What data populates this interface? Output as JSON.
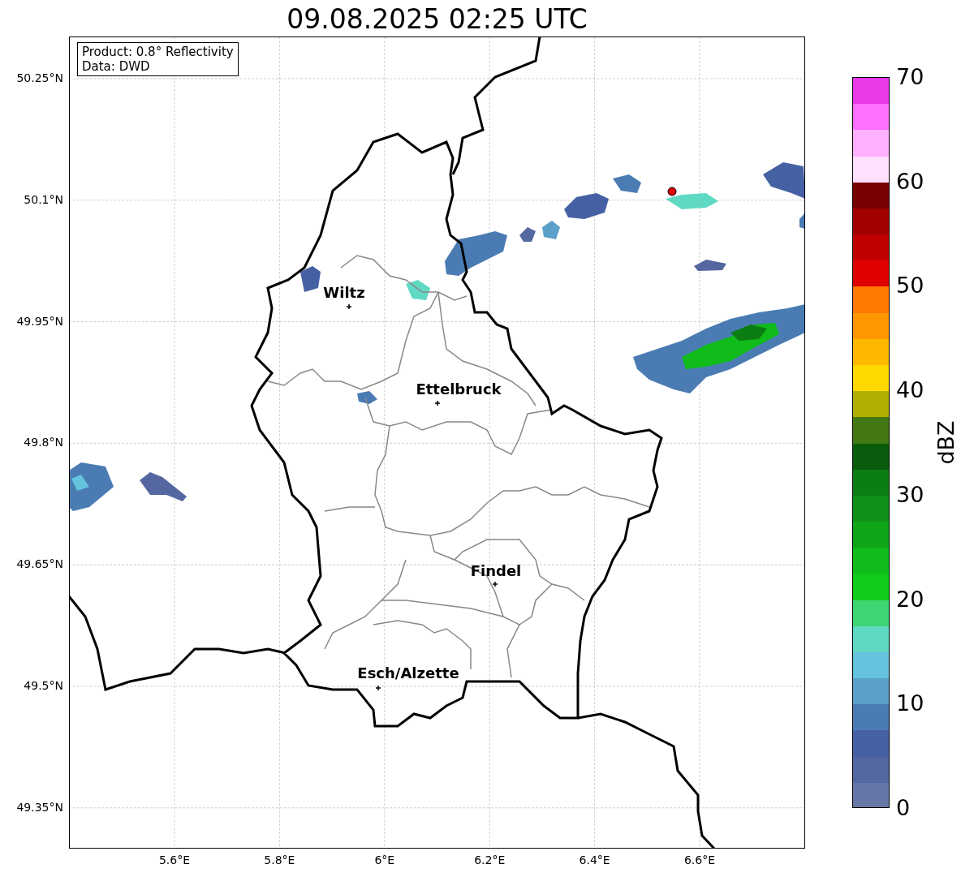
{
  "title": "09.08.2025 02:25 UTC",
  "info_box": {
    "lines": [
      "Product: 0.8° Reflectivity",
      "Data: DWD"
    ]
  },
  "map": {
    "x_ticks": [
      "5.6°E",
      "5.8°E",
      "6°E",
      "6.2°E",
      "6.4°E",
      "6.6°E"
    ],
    "y_ticks": [
      "50.25°N",
      "50.1°N",
      "49.95°N",
      "49.8°N",
      "49.65°N",
      "49.5°N",
      "49.35°N"
    ],
    "cities": [
      {
        "name": "Wiltz"
      },
      {
        "name": "Ettelbruck"
      },
      {
        "name": "Findel"
      },
      {
        "name": "Esch/Alzette"
      }
    ]
  },
  "colorbar": {
    "label": "dBZ",
    "ticks": [
      "70",
      "60",
      "50",
      "40",
      "30",
      "20",
      "10",
      "0"
    ],
    "segments": [
      {
        "color": "#e838e8"
      },
      {
        "color": "#ff70ff"
      },
      {
        "color": "#ffb0ff"
      },
      {
        "color": "#ffe0ff"
      },
      {
        "color": "#780000"
      },
      {
        "color": "#a00000"
      },
      {
        "color": "#c00000"
      },
      {
        "color": "#e00000"
      },
      {
        "color": "#ff7800"
      },
      {
        "color": "#ff9800"
      },
      {
        "color": "#ffb800"
      },
      {
        "color": "#ffd800"
      },
      {
        "color": "#b0b000"
      },
      {
        "color": "#447812"
      },
      {
        "color": "#085c0c"
      },
      {
        "color": "#0c7d12"
      },
      {
        "color": "#0f9016"
      },
      {
        "color": "#10a418"
      },
      {
        "color": "#10bb1a"
      },
      {
        "color": "#12cc1c"
      },
      {
        "color": "#3ed672"
      },
      {
        "color": "#60d9c3"
      },
      {
        "color": "#66c3de"
      },
      {
        "color": "#5ba0c8"
      },
      {
        "color": "#4a7cb3"
      },
      {
        "color": "#4661a3"
      },
      {
        "color": "#5567a0"
      },
      {
        "color": "#6577a6"
      }
    ]
  }
}
